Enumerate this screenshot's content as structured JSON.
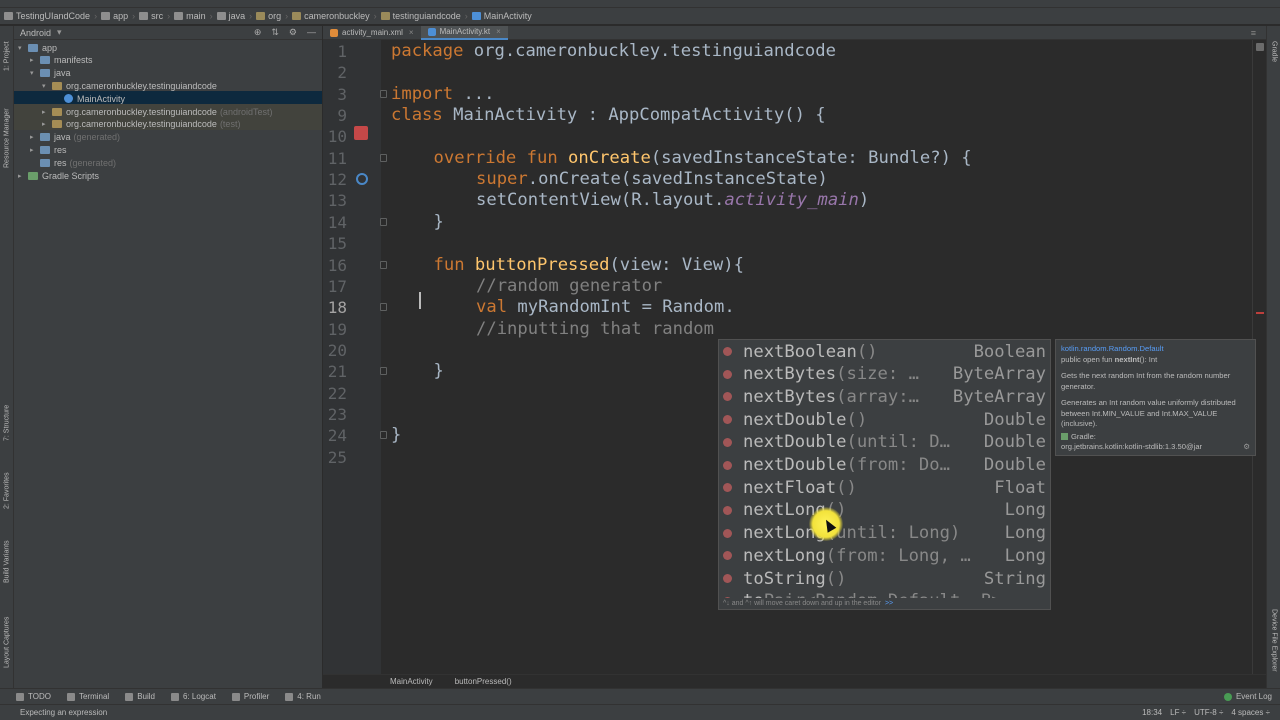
{
  "breadcrumbs": [
    "TestingUIandCode",
    "app",
    "src",
    "main",
    "java",
    "org",
    "cameronbuckley",
    "testinguiandcode",
    "MainActivity"
  ],
  "project_panel": {
    "view_label": "Android",
    "tree": [
      {
        "label": "app",
        "suffix": "",
        "level": 0,
        "arrow": "▾",
        "icon": "blue"
      },
      {
        "label": "manifests",
        "suffix": "",
        "level": 1,
        "arrow": "▸",
        "icon": "blue"
      },
      {
        "label": "java",
        "suffix": "",
        "level": 1,
        "arrow": "▾",
        "icon": "blue"
      },
      {
        "label": "org.cameronbuckley.testinguiandcode",
        "suffix": "",
        "level": 2,
        "arrow": "▾",
        "icon": "pkg"
      },
      {
        "label": "MainActivity",
        "suffix": "",
        "level": 3,
        "arrow": "",
        "icon": "kt"
      },
      {
        "label": "org.cameronbuckley.testinguiandcode",
        "suffix": "(androidTest)",
        "level": 2,
        "arrow": "▸",
        "icon": "pkg"
      },
      {
        "label": "org.cameronbuckley.testinguiandcode",
        "suffix": "(test)",
        "level": 2,
        "arrow": "▸",
        "icon": "pkg"
      },
      {
        "label": "java",
        "suffix": "(generated)",
        "level": 1,
        "arrow": "▸",
        "icon": "blue"
      },
      {
        "label": "res",
        "suffix": "",
        "level": 1,
        "arrow": "▸",
        "icon": "blue"
      },
      {
        "label": "res",
        "suffix": "(generated)",
        "level": 1,
        "arrow": "",
        "icon": "blue"
      },
      {
        "label": "Gradle Scripts",
        "suffix": "",
        "level": 0,
        "arrow": "▸",
        "icon": "gradle"
      }
    ]
  },
  "left_tool_tabs": [
    "1: Project",
    "Resource Manager",
    "7: Structure",
    "2: Favorites",
    "Build Variants",
    "Layout Captures"
  ],
  "right_tool_tabs": [
    "Gradle",
    "Device File Explorer"
  ],
  "editor_tabs": [
    {
      "label": "activity_main.xml",
      "active": false
    },
    {
      "label": "MainActivity.kt",
      "active": true
    }
  ],
  "line_numbers": [
    "1",
    "2",
    "3",
    "9",
    "10",
    "11",
    "12",
    "13",
    "14",
    "15",
    "16",
    "17",
    "18",
    "19",
    "20",
    "21",
    "22",
    "23",
    "24",
    "25"
  ],
  "code": {
    "l1_kw": "package",
    "l1_rest": " org.cameronbuckley.testinguiandcode",
    "l3_kw": "import",
    "l3_rest": " ...",
    "l9_kw": "class",
    "l9_rest": " MainActivity : AppCompatActivity() {",
    "l11_kw1": "override fun ",
    "l11_fn": "onCreate",
    "l11_rest": "(savedInstanceState: Bundle?) {",
    "l12_kw": "super",
    "l12_rest": ".onCreate(savedInstanceState)",
    "l13_a": "setContentView(R.layout.",
    "l13_it": "activity_main",
    "l13_b": ")",
    "l14": "}",
    "l16_kw": "fun ",
    "l16_fn": "buttonPressed",
    "l16_rest": "(view: View){",
    "l17": "//random generator",
    "l18_kw": "val",
    "l18_rest": " myRandomInt = Random.",
    "l19": "//inputting that random",
    "l21": "}",
    "l24": "}"
  },
  "breadcrumb_bottom": [
    "MainActivity",
    "buttonPressed()"
  ],
  "completion": {
    "items": [
      {
        "name": "nextBoolean",
        "sig": "()",
        "type": "Boolean"
      },
      {
        "name": "nextBytes",
        "sig": "(size: …",
        "type": "ByteArray"
      },
      {
        "name": "nextBytes",
        "sig": "(array:…",
        "type": "ByteArray"
      },
      {
        "name": "nextDouble",
        "sig": "()",
        "type": "Double"
      },
      {
        "name": "nextDouble",
        "sig": "(until: D…",
        "type": "Double"
      },
      {
        "name": "nextDouble",
        "sig": "(from: Do…",
        "type": "Double"
      },
      {
        "name": "nextFloat",
        "sig": "()",
        "type": "Float"
      },
      {
        "name": "nextLong",
        "sig": "()",
        "type": "Long"
      },
      {
        "name": "nextLong",
        "sig": "(until: Long)",
        "type": "Long"
      },
      {
        "name": "nextLong",
        "sig": "(from: Long, …",
        "type": "Long"
      },
      {
        "name": "toString",
        "sig": "()",
        "type": "String"
      },
      {
        "name": "to",
        "sig": "    Pair<Random.Default, B>",
        "type": ""
      }
    ],
    "footer": "^↓ and ^↑ will move caret down and up in the editor",
    "footer_link": ">>"
  },
  "doc": {
    "fqname": "kotlin.random.Random.Default",
    "signature_prefix": "public open fun ",
    "signature_name": "nextInt",
    "signature_suffix": "(): Int",
    "p1": "Gets the next random Int from the random number generator.",
    "p2": "Generates an Int random value uniformly distributed between Int.MIN_VALUE and Int.MAX_VALUE (inclusive).",
    "gradle_label": "Gradle:",
    "gradle_lib": "org.jetbrains.kotlin:kotlin-stdlib:1.3.50@jar"
  },
  "bottom_tools": [
    "TODO",
    "Terminal",
    "Build",
    "6: Logcat",
    "Profiler",
    "4: Run"
  ],
  "event_log": "Event Log",
  "status": {
    "message": "Expecting an expression",
    "position": "18:34",
    "line_sep": "LF ÷",
    "encoding": "UTF-8 ÷",
    "indent": "4 spaces ÷"
  }
}
